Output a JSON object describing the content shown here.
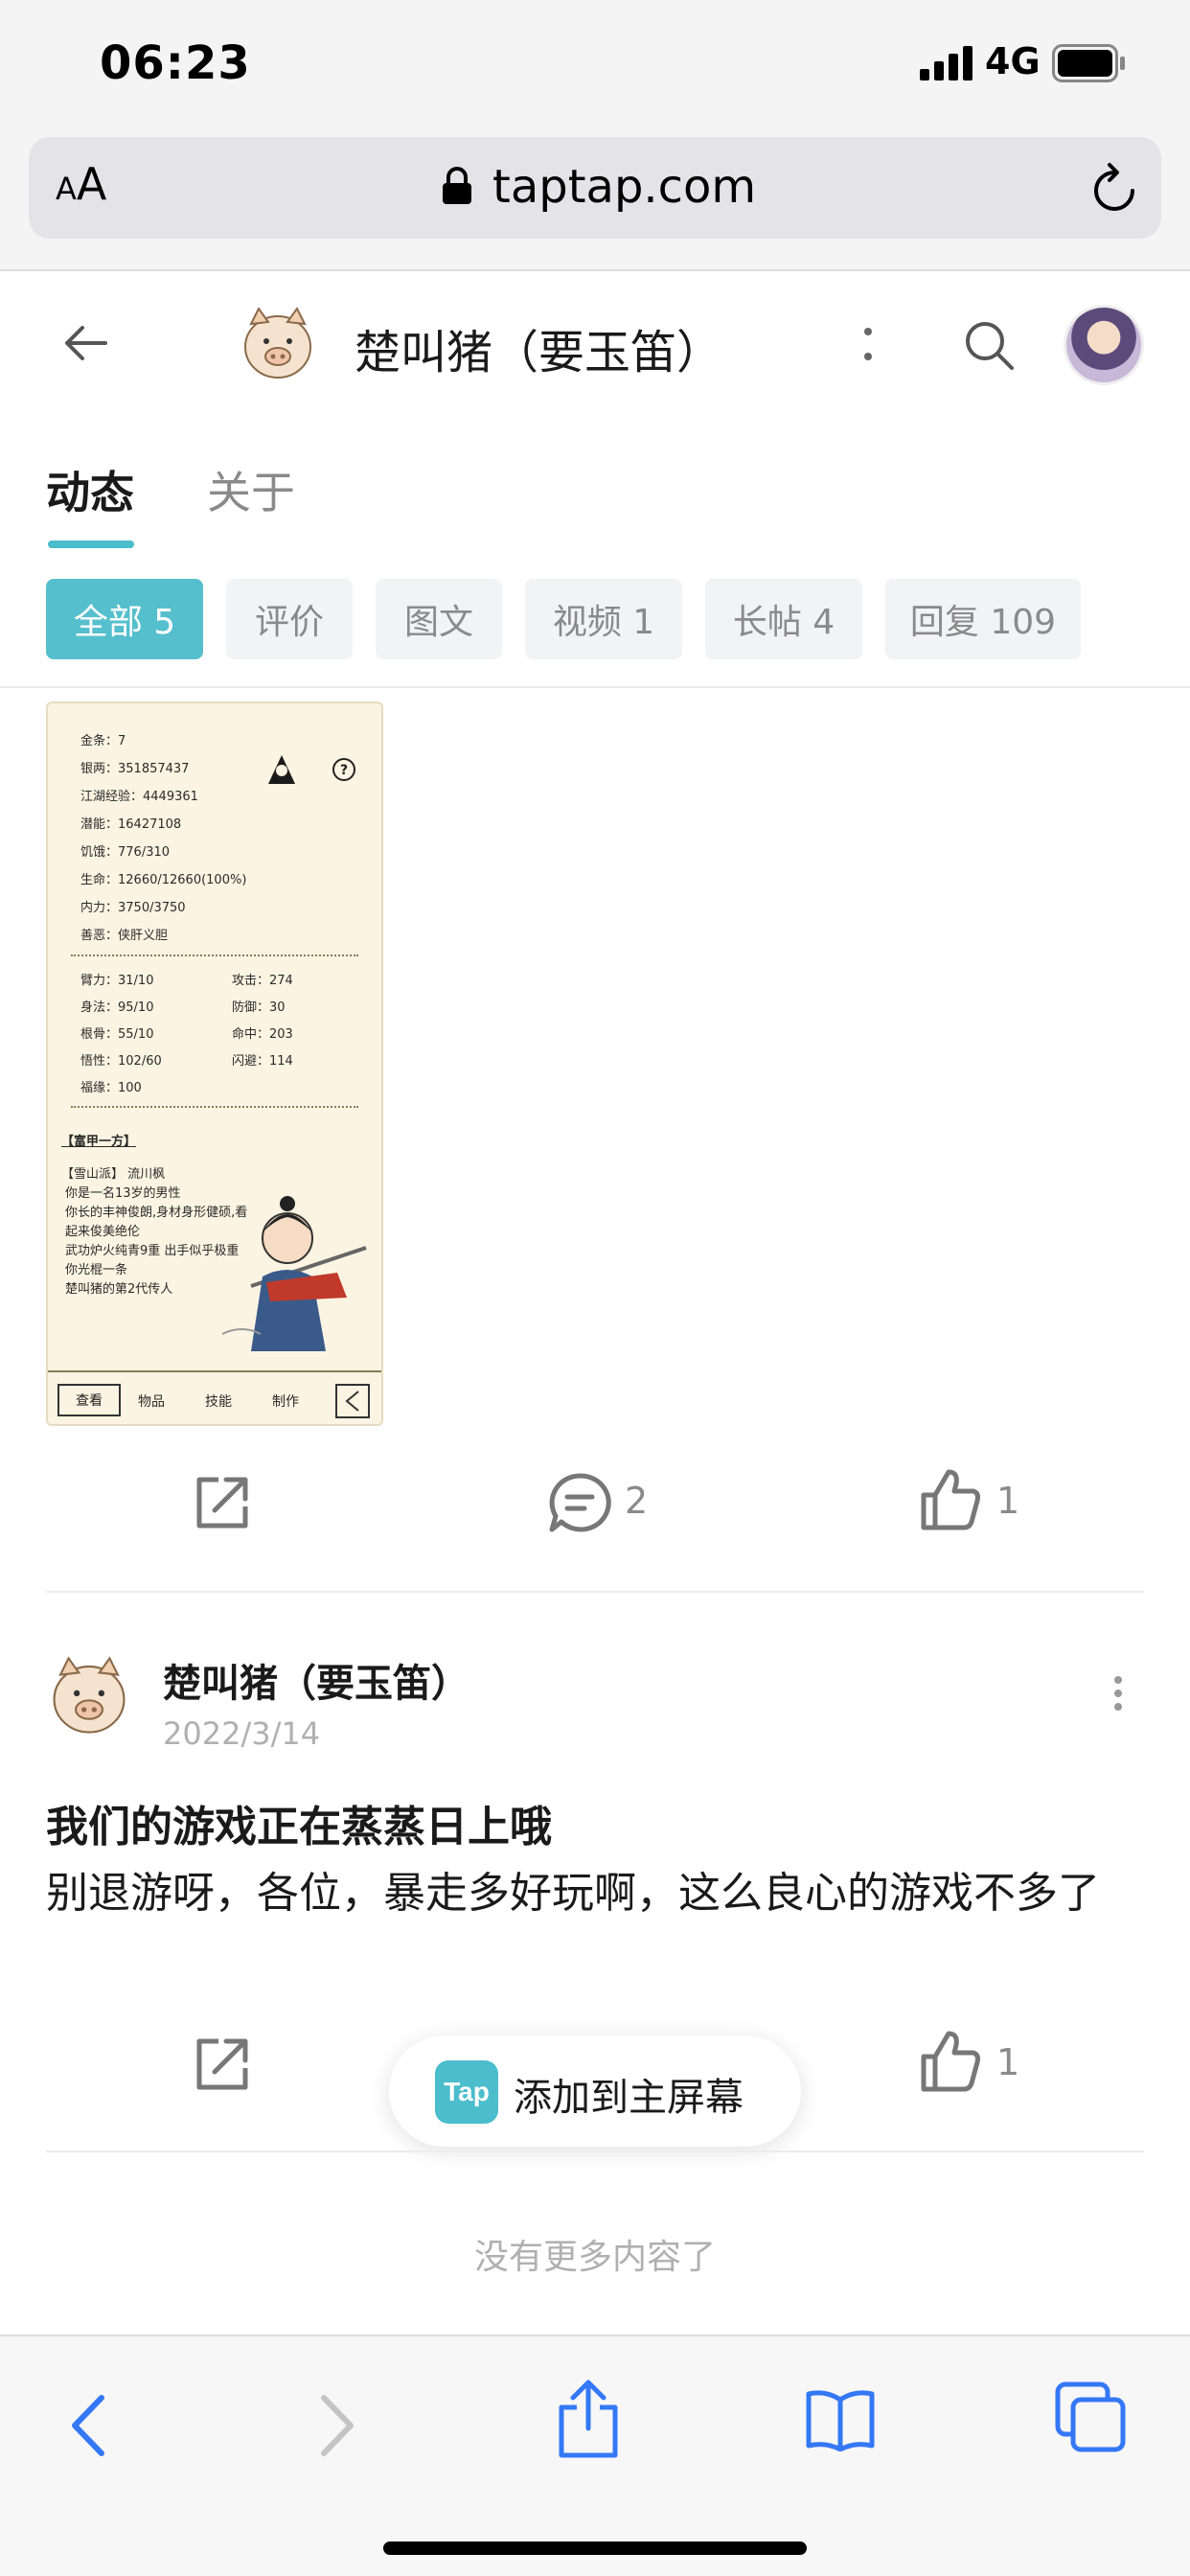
{
  "status_bar": {
    "time": "06:23",
    "network": "4G"
  },
  "browser": {
    "text_size_label": "AA",
    "url": "taptap.com"
  },
  "header": {
    "name": "楚叫猪（要玉笛）"
  },
  "tabs": [
    {
      "label": "动态"
    },
    {
      "label": "关于"
    }
  ],
  "filters": [
    {
      "label": "全部 5",
      "active": true
    },
    {
      "label": "评价",
      "active": false
    },
    {
      "label": "图文",
      "active": false
    },
    {
      "label": "视频 1",
      "active": false
    },
    {
      "label": "长帖 4",
      "active": false
    },
    {
      "label": "回复 109",
      "active": false
    }
  ],
  "post1": {
    "image_stats": {
      "gold": "金条：7",
      "silver": "银两：351857437",
      "exp": "江湖经验：4449361",
      "potential": "潜能：16427108",
      "hunger": "饥饿：776/310",
      "life": "生命：12660/12660(100%)",
      "mana": "内力：3750/3750",
      "karma": "善恶：侠肝义胆",
      "arm": "臂力：31/10",
      "attack": "攻击：274",
      "agility": "身法：95/10",
      "defense": "防御：30",
      "bone": "根骨：55/10",
      "hit": "命中：203",
      "wisdom": "悟性：102/60",
      "dodge": "闪避：114",
      "luck": "福缘：100",
      "title": "【富甲一方】",
      "sect": "【雪山派】 流川枫",
      "desc1": "你是一名13岁的男性",
      "desc2": "你长的丰神俊朗,身材身形健硕,看",
      "desc3": "起来俊美绝伦",
      "desc4": "武功炉火纯青9重 出手似乎极重",
      "desc5": "你光棍一条",
      "desc6": "楚叫猪的第2代传人",
      "tab_view": "查看",
      "tab_items": "物品",
      "tab_skills": "技能",
      "tab_craft": "制作"
    },
    "comments": "2",
    "likes": "1"
  },
  "post2": {
    "author": "楚叫猪（要玉笛）",
    "date": "2022/3/14",
    "title": "我们的游戏正在蒸蒸日上哦",
    "body": "别退游呀，各位，暴走多好玩啊，这么良心的游戏不多了",
    "likes": "1"
  },
  "add_home": {
    "logo": "Tap",
    "label": "添加到主屏幕"
  },
  "end_text": "没有更多内容了",
  "colors": {
    "accent": "#56bfcd",
    "toolbar_blue": "#3478f6"
  }
}
